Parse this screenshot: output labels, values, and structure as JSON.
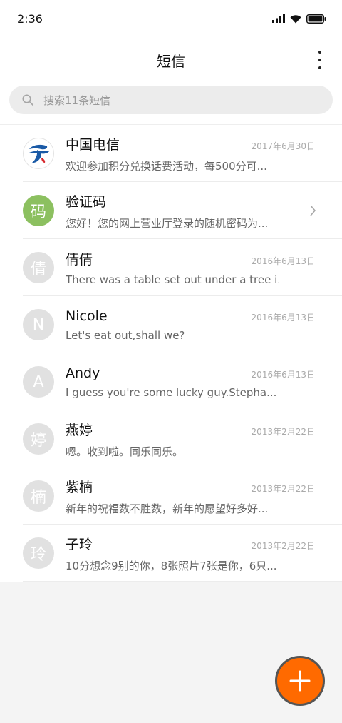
{
  "status_bar": {
    "time": "2:36"
  },
  "header": {
    "title": "短信"
  },
  "search": {
    "placeholder": "搜索11条短信"
  },
  "conversations": [
    {
      "avatar": "",
      "name": "中国电信",
      "date": "2017年6月30日",
      "preview": "欢迎参加积分兑换话费活动，每500分可..."
    },
    {
      "avatar": "码",
      "name": "验证码",
      "date": "",
      "preview": "您好！您的网上营业厅登录的随机密码为..."
    },
    {
      "avatar": "倩",
      "name": "倩倩",
      "date": "2016年6月13日",
      "preview": "There was a table set out under a tree i..."
    },
    {
      "avatar": "N",
      "name": "Nicole",
      "date": "2016年6月13日",
      "preview": "Let's eat out,shall we?"
    },
    {
      "avatar": "A",
      "name": "Andy",
      "date": "2016年6月13日",
      "preview": "I guess you're some lucky guy.Stepha..."
    },
    {
      "avatar": "婷",
      "name": "燕婷",
      "date": "2013年2月22日",
      "preview": "嗯。收到啦。同乐同乐。"
    },
    {
      "avatar": "楠",
      "name": "紫楠",
      "date": "2013年2月22日",
      "preview": "新年的祝福数不胜数，新年的愿望好多好..."
    },
    {
      "avatar": "玲",
      "name": "子玲",
      "date": "2013年2月22日",
      "preview": "10分想念9别的你，8张照片7张是你，6只..."
    }
  ],
  "colors": {
    "accent": "#ff6a00",
    "avatar_green": "#8cc060",
    "avatar_gray": "#e1e1e1",
    "telecom_blue": "#1a5aa6"
  },
  "icons": {
    "search": "search-icon",
    "more": "more-vertical-icon",
    "chevron": "chevron-right-icon",
    "fab": "plus-icon"
  }
}
